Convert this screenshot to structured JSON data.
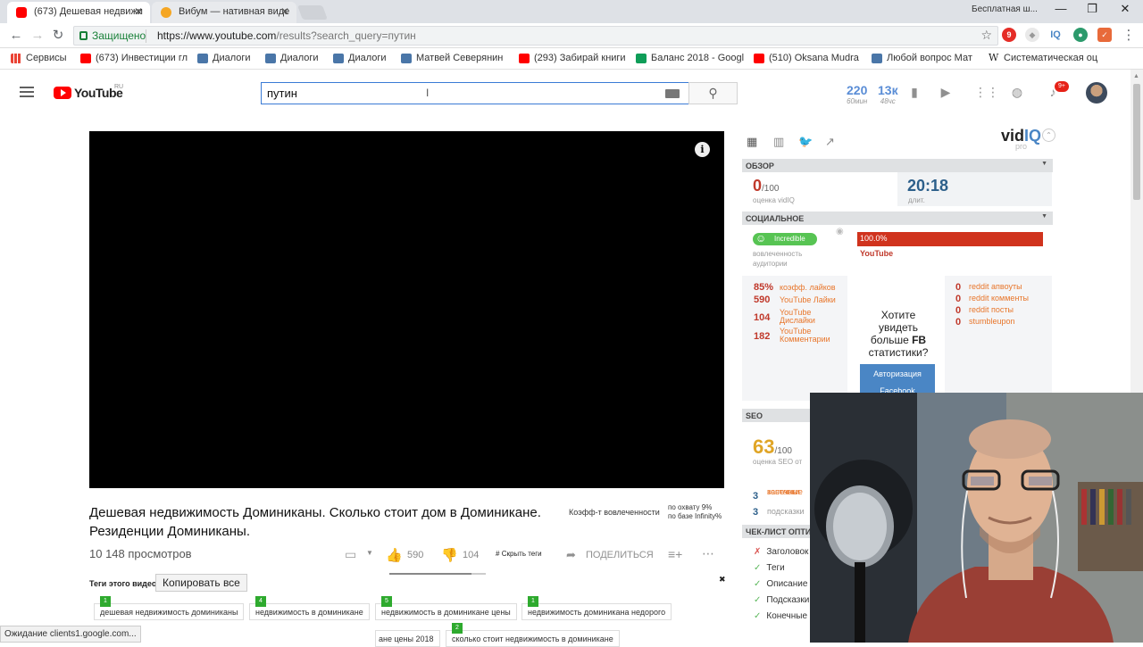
{
  "browser": {
    "tabs": [
      {
        "label": "(673) Дешевая недвижи"
      },
      {
        "label": "Вибум — нативная виде"
      }
    ],
    "window_label": "Бесплатная ш...",
    "secure_label": "Защищено",
    "url_host": "https://www.youtube.com",
    "url_path": "/results?search_query=путин",
    "extensions": {
      "iq_label": "IQ"
    },
    "bookmarks": [
      {
        "label": "Сервисы",
        "color": "#4285f4"
      },
      {
        "label": "(673) Инвестиции гл",
        "color": "#ff0000"
      },
      {
        "label": "Диалоги",
        "color": "#4a76a8"
      },
      {
        "label": "Диалоги",
        "color": "#4a76a8"
      },
      {
        "label": "Диалоги",
        "color": "#4a76a8"
      },
      {
        "label": "Матвей Северянин",
        "color": "#4a76a8"
      },
      {
        "label": "(293) Забирай книги",
        "color": "#ff0000"
      },
      {
        "label": "Баланс 2018 - Googl",
        "color": "#0f9d58"
      },
      {
        "label": "(510) Oksana Mudra",
        "color": "#ff0000"
      },
      {
        "label": "Любой вопрос Мат",
        "color": "#4a76a8"
      },
      {
        "label": "Систематическая оц",
        "color": "#ffffff"
      }
    ],
    "status": "Ожидание clients1.google.com..."
  },
  "youtube": {
    "logo_text": "YouTube",
    "logo_region": "RU",
    "search_value": "путин",
    "stats": [
      {
        "value": "220",
        "label": "60мин"
      },
      {
        "value": "13к",
        "label": "48чс"
      }
    ],
    "notif_count": "9+",
    "video": {
      "title": "Дешевая недвижимость Доминиканы. Сколько стоит дом в Доминикане. Резиденции Доминиканы.",
      "engage_label": "Коэфф-т вовлеченности",
      "reach_line1": "по охвату 9%",
      "reach_line2": "по базе Infinity%",
      "views": "10 148 просмотров",
      "likes": "590",
      "dislikes": "104",
      "like_ratio": 0.85,
      "hide_tags": "Скрыть теги",
      "share": "ПОДЕЛИТЬСЯ",
      "tags_heading": "Теги этого видео",
      "copy_all": "Копировать все",
      "tags": [
        {
          "rank": "1",
          "text": "дешевая недвижимость доминиканы"
        },
        {
          "rank": "4",
          "text": "недвижимость в доминикане"
        },
        {
          "rank": "5",
          "text": "недвижимость в доминикане цены"
        },
        {
          "rank": "1",
          "text": "недвижимость доминикана недорого"
        },
        {
          "rank": "",
          "text": "ане цены 2018"
        },
        {
          "rank": "2",
          "text": "сколько стоит недвижимость в доминикане"
        }
      ]
    }
  },
  "vidiq": {
    "logo_main": "vid",
    "logo_iq": "IQ",
    "logo_pro": "pro",
    "overview": {
      "heading": "ОБЗОР",
      "score": "0",
      "score_of": "/100",
      "score_label": "оценка vidIQ",
      "duration": "20:18",
      "duration_label": "длит."
    },
    "social": {
      "heading": "СОЦИАЛЬНОЕ",
      "engagement_badge": "Incredible",
      "engagement_label_1": "вовлеченность",
      "engagement_label_2": "аудитории",
      "yt_share": "100.0%",
      "yt_label": "YouTube",
      "left_rows": [
        {
          "value": "85%",
          "label": "коэфф. лайков"
        },
        {
          "value": "590",
          "label": "YouTube Лайки"
        },
        {
          "value": "104",
          "label": "YouTube Дислайки"
        },
        {
          "value": "182",
          "label": "YouTube Комментарии"
        }
      ],
      "right_rows": [
        {
          "value": "0",
          "label": "reddit апвоуты"
        },
        {
          "value": "0",
          "label": "reddit комменты"
        },
        {
          "value": "0",
          "label": "reddit посты"
        },
        {
          "value": "0",
          "label": "stumbleupon"
        }
      ],
      "fb_question_1": "Хотите",
      "fb_question_2": "увидеть",
      "fb_question_3": "больше",
      "fb_question_bold": "FB",
      "fb_question_4": "статистики?",
      "fb_button_1": "Авторизация",
      "fb_button_2": "Facebook"
    },
    "seo": {
      "heading": "SEO",
      "score": "63",
      "score_of": "/100",
      "score_label": "оценка SEO от",
      "rows": [
        {
          "value": "3",
          "label_1": "конечные",
          "label_2": "заставки"
        },
        {
          "value": "3",
          "label_1": "подсказки",
          "label_2": ""
        }
      ]
    },
    "checklist": {
      "heading": "ЧЕК-ЛИСТ ОПТИ",
      "items": [
        {
          "mark": "✗",
          "label": "Заголовок",
          "color": "#d9534f"
        },
        {
          "mark": "✓",
          "label": "Теги",
          "color": "#5cb85c"
        },
        {
          "mark": "✓",
          "label": "Описание",
          "color": "#5cb85c"
        },
        {
          "mark": "✓",
          "label": "Подсказки",
          "color": "#5cb85c"
        },
        {
          "mark": "✓",
          "label": "Конечные",
          "color": "#5cb85c"
        }
      ]
    }
  }
}
